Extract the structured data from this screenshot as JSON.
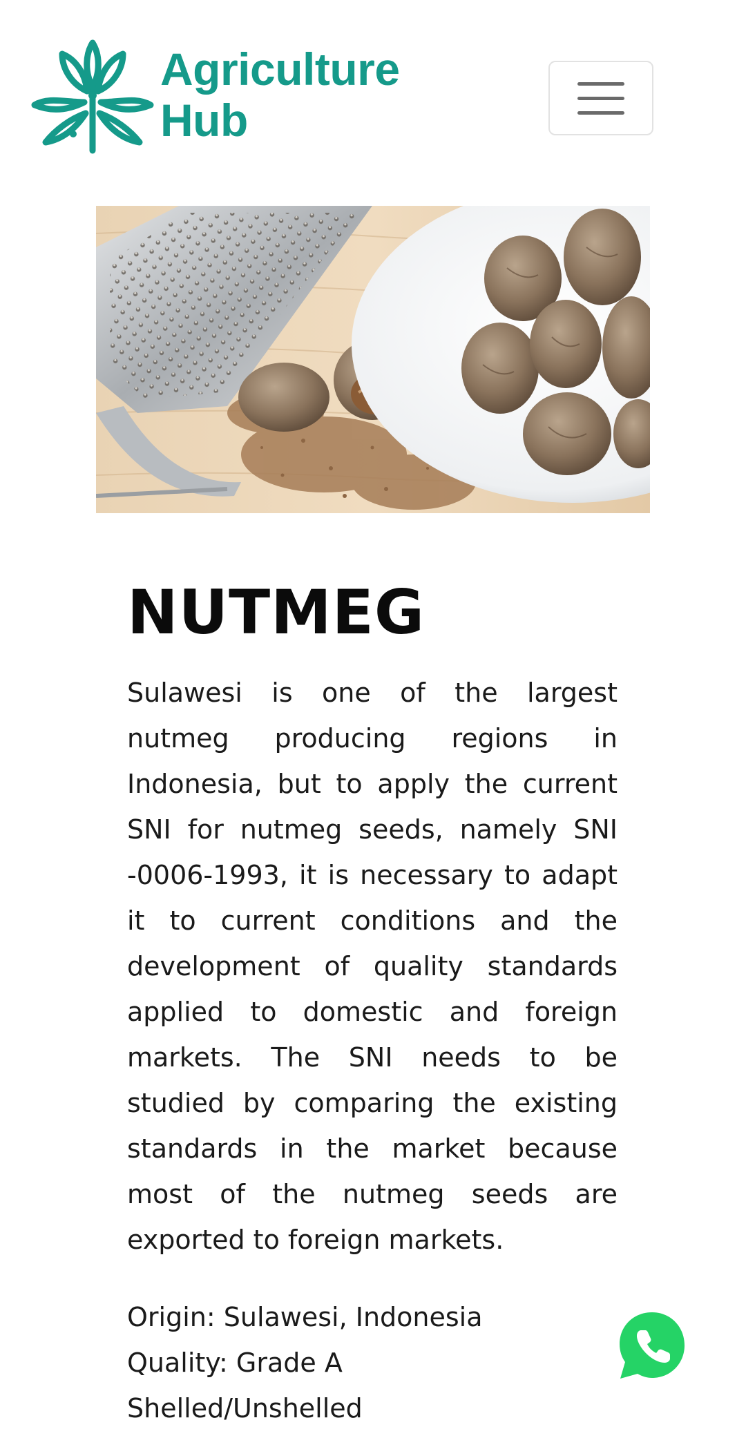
{
  "brand": {
    "line1": "Agriculture",
    "line2": "Hub",
    "color": "#159a8a"
  },
  "header": {
    "menu_icon": "hamburger-menu-icon"
  },
  "hero": {
    "image": "nutmeg-with-grater-photo"
  },
  "product": {
    "title": "NUTMEG",
    "description": "Sulawesi is one of the largest nutmeg producing regions in Indonesia, but to apply the current SNI for nutmeg seeds, namely SNI -0006-1993, it is necessary to adapt it to current conditions and the development of quality standards applied to domestic and foreign markets. The SNI needs to be studied by comparing the existing standards in the market because most of the nutmeg seeds are exported to foreign markets.",
    "specs": [
      "Origin: Sulawesi, Indonesia",
      "Quality: Grade A",
      "Shelled/Unshelled"
    ]
  },
  "whatsapp": {
    "icon": "whatsapp-icon",
    "color": "#25d366"
  }
}
